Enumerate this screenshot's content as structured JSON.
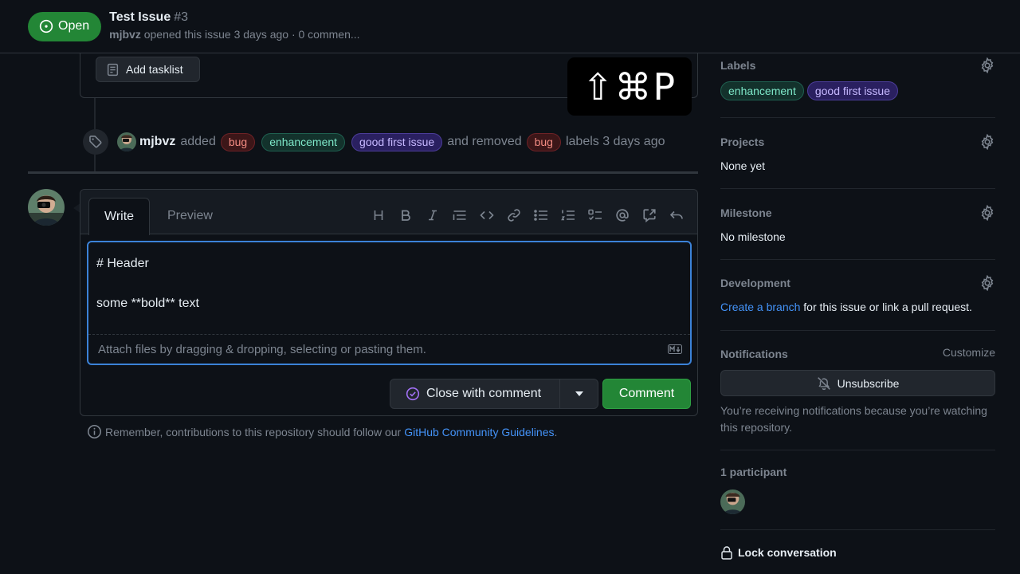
{
  "header": {
    "state": "Open",
    "title": "Test Issue",
    "number": "#3",
    "author": "mjbvz",
    "meta": "opened this issue 3 days ago · 0 commen..."
  },
  "tasklist": {
    "label": "Add tasklist"
  },
  "event": {
    "author": "mjbvz",
    "added_text": "added",
    "added_labels": [
      "bug",
      "enhancement",
      "good first issue"
    ],
    "removed_text": "and removed",
    "removed_labels": [
      "bug"
    ],
    "suffix": "labels 3 days ago"
  },
  "shortcut": {
    "keys": "⇧⌘P"
  },
  "composer": {
    "tab_write": "Write",
    "tab_preview": "Preview",
    "toolbar_icons": [
      "heading-icon",
      "bold-icon",
      "italic-icon",
      "quote-icon",
      "code-icon",
      "link-icon",
      "unordered-list-icon",
      "ordered-list-icon",
      "task-list-icon",
      "mention-icon",
      "cross-reference-icon",
      "reply-icon"
    ],
    "text": "# Header\n\nsome **bold** text",
    "attach_hint": "Attach files by dragging & dropping, selecting or pasting them.",
    "close_button": "Close with comment",
    "comment_button": "Comment"
  },
  "guideline": {
    "prefix": "Remember, contributions to this repository should follow our",
    "link": "GitHub Community Guidelines",
    "suffix": "."
  },
  "sidebar": {
    "labels": {
      "title": "Labels",
      "items": [
        "enhancement",
        "good first issue"
      ]
    },
    "projects": {
      "title": "Projects",
      "value": "None yet"
    },
    "milestone": {
      "title": "Milestone",
      "value": "No milestone"
    },
    "development": {
      "title": "Development",
      "link": "Create a branch",
      "rest": " for this issue or link a pull request."
    },
    "notifications": {
      "title": "Notifications",
      "customize": "Customize",
      "button": "Unsubscribe",
      "note": "You’re receiving notifications because you’re watching this repository."
    },
    "participants": {
      "title": "1 participant"
    },
    "lock": "Lock conversation"
  },
  "colors": {
    "accent_green": "#238636",
    "link_blue": "#4493f8",
    "focus_blue": "#3b82d8"
  }
}
